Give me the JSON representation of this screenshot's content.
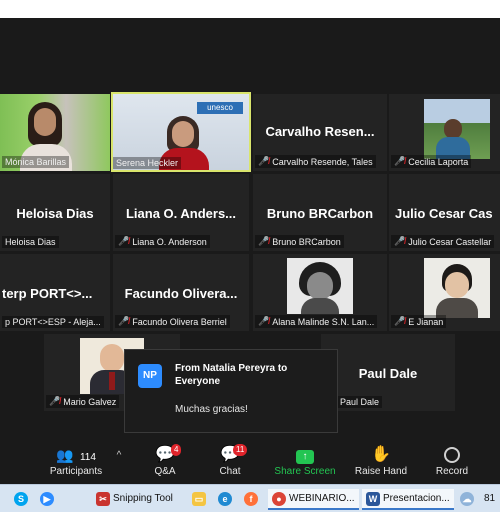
{
  "tiles": [
    {
      "label": "Mónica Barillas",
      "muted": false
    },
    {
      "label": "Serena Heckler",
      "muted": false,
      "badge": "unesco"
    },
    {
      "big": "Carvalho Resen...",
      "label": "Carvalho Resende, Tales",
      "muted": true
    },
    {
      "label": "Cecilia Laporta",
      "muted": true
    },
    {
      "big": "Heloisa Dias",
      "label": "Heloisa Dias",
      "muted": false
    },
    {
      "big": "Liana O. Anders...",
      "label": "Liana O. Anderson",
      "muted": true
    },
    {
      "big": "Bruno BRCarbon",
      "label": "Bruno BRCarbon",
      "muted": true
    },
    {
      "big": "Julio Cesar Cas",
      "label": "Julio Cesar Castellar",
      "muted": true
    },
    {
      "big": "terp PORT<>...",
      "label": "p PORT<>ESP - Aleja...",
      "muted": false
    },
    {
      "big": "Facundo Olivera...",
      "label": "Facundo Olivera Berriel",
      "muted": true
    },
    {
      "label": "Alana Malinde S.N. Lan...",
      "muted": true
    },
    {
      "label": "E Jianan",
      "muted": true
    },
    {
      "label": "Mario Galvez",
      "muted": true
    },
    {
      "big": "Paul Dale",
      "label": "Paul Dale",
      "muted": false
    }
  ],
  "chat_popup": {
    "avatar_initials": "NP",
    "from": "From Natalia Pereyra to Everyone",
    "message": "Muchas gracias!"
  },
  "toolbar": {
    "participants_count": "114",
    "participants_label": "Participants",
    "qa_label": "Q&A",
    "qa_badge": "4",
    "chat_label": "Chat",
    "chat_badge": "11",
    "share_label": "Share Screen",
    "raise_label": "Raise Hand",
    "record_label": "Record"
  },
  "taskbar": {
    "snipping": "Snipping Tool",
    "webinario": "WEBINARIO...",
    "presentacion": "Presentacion...",
    "battery": "81"
  },
  "colors": {
    "accent": "#2d8cff",
    "share_green": "#23c552",
    "badge_red": "#e0242b",
    "active_speaker": "#d9e56c"
  }
}
